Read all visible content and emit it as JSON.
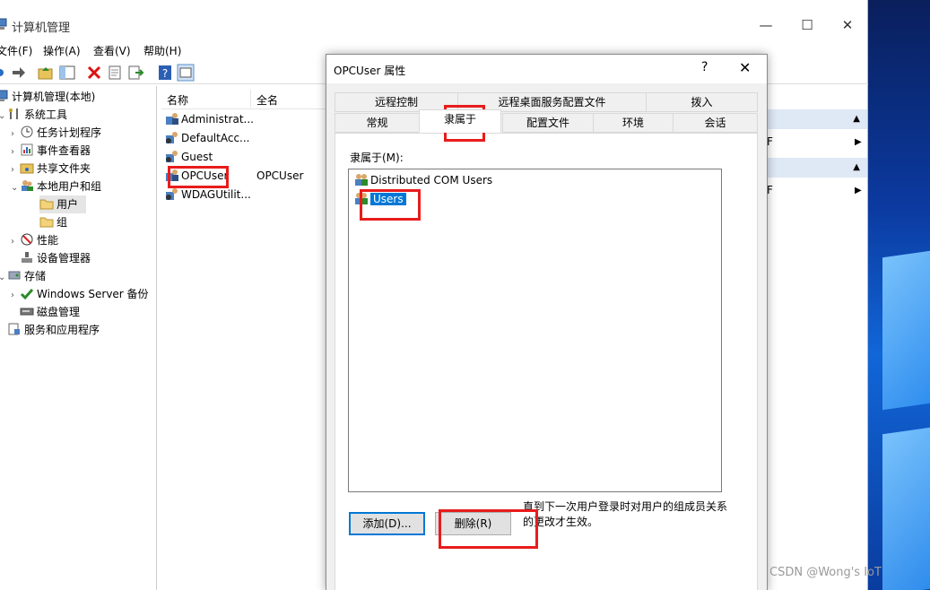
{
  "window": {
    "title": "计算机管理",
    "controls": {
      "minimize": "—",
      "maximize": "☐",
      "close": "✕"
    }
  },
  "menu": [
    "文件(F)",
    "操作(A)",
    "查看(V)",
    "帮助(H)"
  ],
  "tree": [
    {
      "label": "计算机管理(本地)",
      "icon": "computer-management-icon"
    },
    {
      "label": "系统工具",
      "icon": "tools-icon"
    },
    {
      "label": "任务计划程序",
      "icon": "clock-icon"
    },
    {
      "label": "事件查看器",
      "icon": "event-viewer-icon"
    },
    {
      "label": "共享文件夹",
      "icon": "shared-folder-icon"
    },
    {
      "label": "本地用户和组",
      "icon": "users-icon"
    },
    {
      "label": "用户",
      "icon": "folder-icon"
    },
    {
      "label": "组",
      "icon": "folder-icon"
    },
    {
      "label": "性能",
      "icon": "performance-icon"
    },
    {
      "label": "设备管理器",
      "icon": "device-manager-icon"
    },
    {
      "label": "存储",
      "icon": "storage-icon"
    },
    {
      "label": "Windows Server 备份",
      "icon": "backup-icon"
    },
    {
      "label": "磁盘管理",
      "icon": "disk-icon"
    },
    {
      "label": "服务和应用程序",
      "icon": "services-icon"
    }
  ],
  "list": {
    "columns": [
      "名称",
      "全名"
    ],
    "rows": [
      {
        "name": "Administrat...",
        "full": ""
      },
      {
        "name": "DefaultAcc...",
        "full": ""
      },
      {
        "name": "Guest",
        "full": ""
      },
      {
        "name": "OPCUser",
        "full": "OPCUser"
      },
      {
        "name": "WDAGUtilit...",
        "full": ""
      }
    ]
  },
  "actions": {
    "sub1": "F",
    "sub2": "F"
  },
  "dialog": {
    "title": "OPCUser 属性",
    "help": "?",
    "close": "✕",
    "tabs_back": [
      "远程控制",
      "远程桌面服务配置文件",
      "拨入"
    ],
    "tabs_front": [
      "常规",
      "隶属于",
      "配置文件",
      "环境",
      "会话"
    ],
    "member_label": "隶属于(M):",
    "members": [
      "Distributed COM Users",
      "Users"
    ],
    "add_button": "添加(D)...",
    "remove_button": "删除(R)",
    "note": "直到下一次用户登录时对用户的组成员关系的更改才生效。"
  },
  "watermark": "CSDN @Wong's IoT",
  "colors": {
    "accent": "#0078d7",
    "highlight_box": "#e81c1c"
  }
}
